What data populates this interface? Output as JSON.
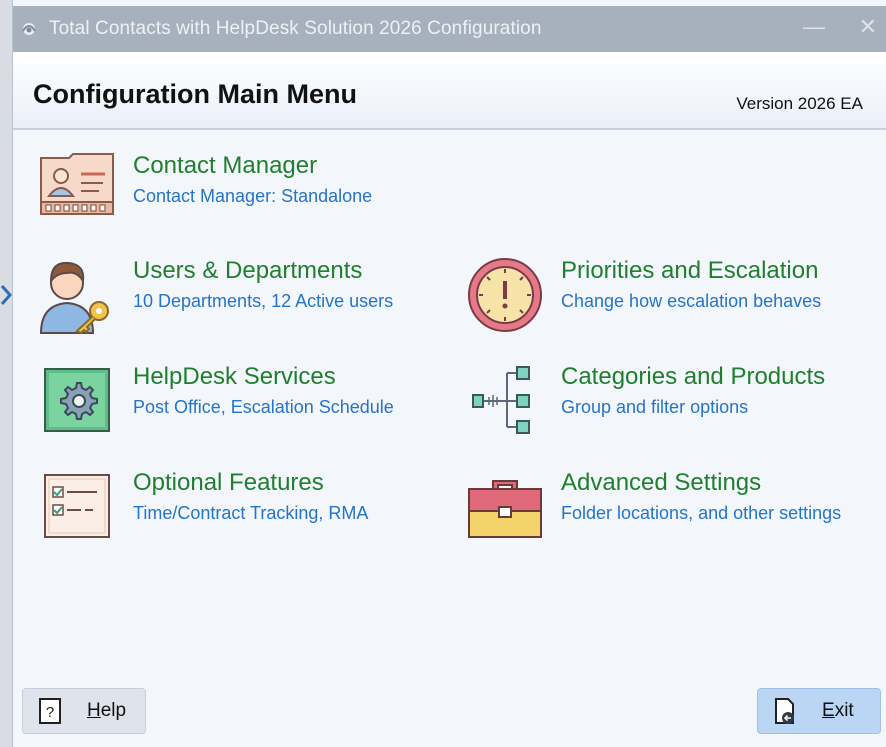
{
  "window": {
    "title": "Total Contacts with HelpDesk Solution 2026 Configuration",
    "minimize_glyph": "—",
    "close_glyph": "✕"
  },
  "header": {
    "heading": "Configuration Main Menu",
    "version": "Version 2026 EA"
  },
  "menu": [
    {
      "label": "Contact Manager",
      "desc": "Contact Manager: Standalone",
      "icon": "contact-card-icon"
    },
    {
      "label": "Users & Departments",
      "desc": "10 Departments, 12 Active users",
      "icon": "user-key-icon"
    },
    {
      "label": "Priorities and Escalation",
      "desc": "Change how escalation behaves",
      "icon": "priority-clock-icon"
    },
    {
      "label": "HelpDesk Services",
      "desc": "Post Office, Escalation Schedule",
      "icon": "gear-board-icon"
    },
    {
      "label": "Categories and Products",
      "desc": "Group and filter options",
      "icon": "hierarchy-icon"
    },
    {
      "label": "Optional Features",
      "desc": "Time/Contract Tracking, RMA",
      "icon": "checklist-icon"
    },
    {
      "label": "Advanced Settings",
      "desc": "Folder locations, and other settings",
      "icon": "toolbox-icon"
    }
  ],
  "buttons": {
    "help": "Help",
    "exit": "Exit"
  },
  "colors": {
    "label_green": "#1f7f2f",
    "desc_blue": "#2474c8",
    "titlebar": "#a7b0bd",
    "exit_button": "#bad6f4"
  }
}
